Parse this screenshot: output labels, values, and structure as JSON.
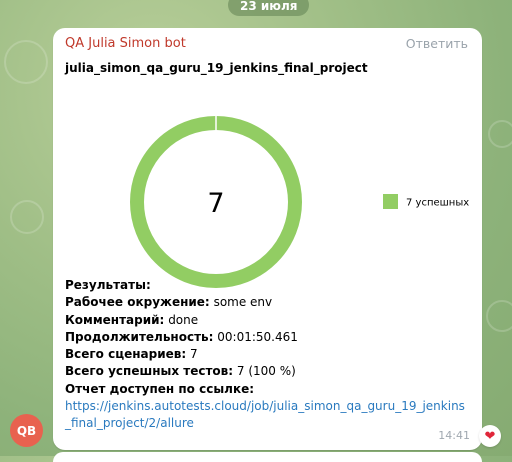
{
  "date_separator": "23 июля",
  "message": {
    "sender": "QA Julia Simon bot",
    "reply_label": "Ответить",
    "project_title": "julia_simon_qa_guru_19_jenkins_final_project",
    "time": "14:41",
    "info": {
      "results_label": "Результаты:",
      "env_label": "Рабочее окружение:",
      "env_value": "some env",
      "comment_label": "Комментарий:",
      "comment_value": "done",
      "duration_label": "Продолжительность:",
      "duration_value": "00:01:50.461",
      "scenarios_label": "Всего сценариев:",
      "scenarios_value": "7",
      "passed_label": "Всего успешных тестов:",
      "passed_value": "7 (100 %)",
      "report_label": "Отчет доступен по ссылке:",
      "report_link_line1": "https://jenkins.autotests.cloud/job/julia_simon_qa_guru_19_jenkins",
      "report_link_line2": "_final_project/2/allure"
    }
  },
  "avatar_initials": "QB",
  "reaction_icon": "heart-icon",
  "chart_data": {
    "type": "pie",
    "center_label": "7",
    "categories": [
      "7 успешных"
    ],
    "values": [
      7
    ],
    "colors": [
      "#92cd63"
    ],
    "legend_position": "right"
  }
}
